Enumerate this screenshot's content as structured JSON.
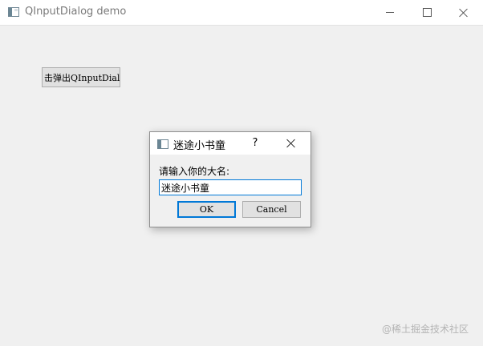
{
  "window": {
    "title": "QInputDialog demo",
    "controls": {
      "minimize_icon": "minimize-icon",
      "maximize_icon": "maximize-icon",
      "close_icon": "close-icon"
    }
  },
  "main": {
    "popup_button_label": "击弹出QInputDial"
  },
  "dialog": {
    "title": "迷途小书童",
    "help_label": "?",
    "prompt": "请输入你的大名:",
    "input_value": "迷途小书童",
    "ok_label": "OK",
    "cancel_label": "Cancel"
  },
  "watermark": "@稀土掘金技术社区",
  "colors": {
    "focus_accent": "#0078d7",
    "button_bg": "#e1e1e1",
    "window_bg": "#f0f0f0"
  }
}
